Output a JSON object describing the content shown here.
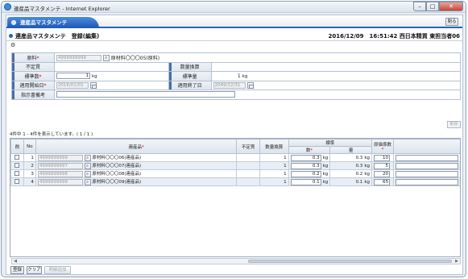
{
  "window": {
    "title": "連産品マスタメンテ - Internet Explorer"
  },
  "tab": {
    "label": "連産品マスタメンテ"
  },
  "close_label": "閉る",
  "header": {
    "page_title": "連産品マスタメンテ　登録(編集)",
    "datetime": "2016/12/09　16:51:42",
    "user": "西日本精買 東担当者06"
  },
  "form": {
    "genryo_label": "原料",
    "genryo_code": "4999999999",
    "genryo_name": "原材料〇〇〇05(原料)",
    "fuyou_label": "不定貫",
    "suryo_label": "数量換算",
    "hyojun_su_label": "標準数",
    "hyojun_su_value": "1",
    "hyojun_su_unit": "kg",
    "hyojun_ryo_label": "標準量",
    "hyojun_ryo_value": "1",
    "hyojun_ryo_unit": "kg",
    "start_label": "適用開始日",
    "start_value": "2016/01/01",
    "end_label": "適用終了日",
    "end_value": "2049/12/31",
    "shiji_label": "指示書備考"
  },
  "delete_label": "削除",
  "count_text": "4件中 1 - 4件を表示しています。( 1 / 1 )",
  "grid": {
    "headers": {
      "del": "削",
      "no": "No",
      "product": "連産品",
      "fuyou": "不定貫",
      "suryo": "数量換算",
      "hyojun": "標準",
      "su": "数",
      "ryo": "量",
      "genka": "原価係数"
    },
    "rows": [
      {
        "no": "1",
        "code": "4999999999",
        "name": "原材料〇〇〇06(連産品)",
        "suryo": "1",
        "su": "0.3",
        "su_unit": "kg",
        "ryo": "0.3",
        "ryo_unit": "kg",
        "genka": "10"
      },
      {
        "no": "2",
        "code": "4999999997",
        "name": "原材料〇〇〇07(連産品)",
        "suryo": "1",
        "su": "0.3",
        "su_unit": "kg",
        "ryo": "0.3",
        "ryo_unit": "kg",
        "genka": "5"
      },
      {
        "no": "3",
        "code": "4999999998",
        "name": "原材料〇〇〇08(連産品)",
        "suryo": "1",
        "su": "0.2",
        "su_unit": "kg",
        "ryo": "0.2",
        "ryo_unit": "kg",
        "genka": "20"
      },
      {
        "no": "4",
        "code": "4999999999",
        "name": "原材料〇〇〇09(連産品)",
        "suryo": "1",
        "su": "0.1",
        "su_unit": "kg",
        "ryo": "0.1",
        "ryo_unit": "kg",
        "genka": "65"
      }
    ]
  },
  "buttons": {
    "register": "登録",
    "clear": "クリア",
    "history": "明細追加"
  },
  "colors": {
    "tab": "#1d58b5",
    "label_accent": "#4a6da3",
    "required": "#cc0000"
  }
}
